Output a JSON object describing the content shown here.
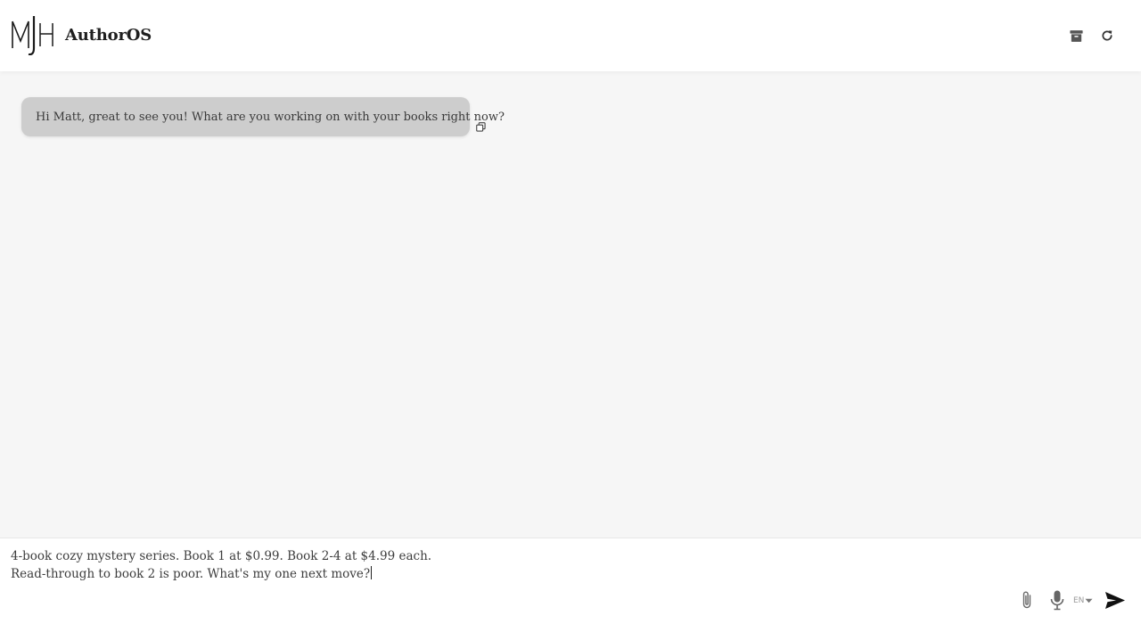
{
  "header": {
    "app_title": "AuthorOS",
    "logo_alt": "MJH",
    "icons": {
      "archive": "archive-icon",
      "refresh": "refresh-icon"
    }
  },
  "chat": {
    "messages": [
      {
        "role": "assistant",
        "text": "Hi Matt, great to see you! What are you working on with your books right now?"
      }
    ],
    "copy_icon": "copy-icon"
  },
  "composer": {
    "value_lines": [
      "4-book cozy mystery series. Book 1 at $0.99. Book 2-4 at $4.99 each.",
      "Read-through to book 2 is poor. What's my one next move?"
    ],
    "language": "EN",
    "icons": {
      "attach": "paperclip-icon",
      "mic": "microphone-icon",
      "language_caret": "caret-down-icon",
      "send": "send-icon"
    }
  },
  "colors": {
    "header_bg": "#ffffff",
    "chat_bg": "#f6f6f6",
    "bubble_bg": "#cdcdcd",
    "text": "#3a3a3a",
    "icon": "#555555"
  }
}
